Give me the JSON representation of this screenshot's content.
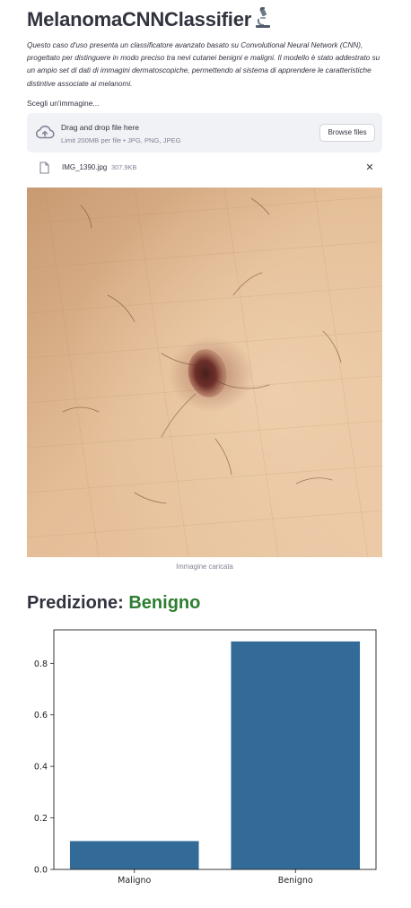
{
  "page": {
    "title": "MelanomaCNNClassifier",
    "title_icon": "microscope-icon",
    "description": "Questo caso d'uso presenta un classificatore avanzato basato su Convolutional Neural Network (CNN), progettato per distinguere in modo preciso tra nevi cutanei benigni e maligni. Il modello è stato addestrato su un ampio set di dati di immagini dermatoscopiche, permettendo al sistema di apprendere le caratteristiche distintive associate ai melanomi."
  },
  "uploader": {
    "label": "Scegli un'immagine...",
    "drop_title": "Drag and drop file here",
    "drop_subtitle": "Limit 200MB per file • JPG, PNG, JPEG",
    "browse_label": "Browse files",
    "icon": "cloud-upload-icon"
  },
  "file": {
    "name": "IMG_1390.jpg",
    "size": "307.9KB",
    "icon": "file-icon",
    "remove_icon": "close-icon",
    "remove_glyph": "✕"
  },
  "image": {
    "caption": "Immagine caricata"
  },
  "prediction": {
    "label": "Predizione:",
    "value": "Benigno",
    "value_color": "#2e7d32"
  },
  "chart_data": {
    "type": "bar",
    "categories": [
      "Maligno",
      "Benigno"
    ],
    "values": [
      0.11,
      0.885
    ],
    "title": "",
    "xlabel": "",
    "ylabel": "",
    "ylim": [
      0,
      0.93
    ],
    "yticks": [
      0.0,
      0.2,
      0.4,
      0.6,
      0.8
    ],
    "ytick_labels": [
      "0.0",
      "0.2",
      "0.4",
      "0.6",
      "0.8"
    ],
    "bar_color": "#336b98",
    "grid": false
  }
}
